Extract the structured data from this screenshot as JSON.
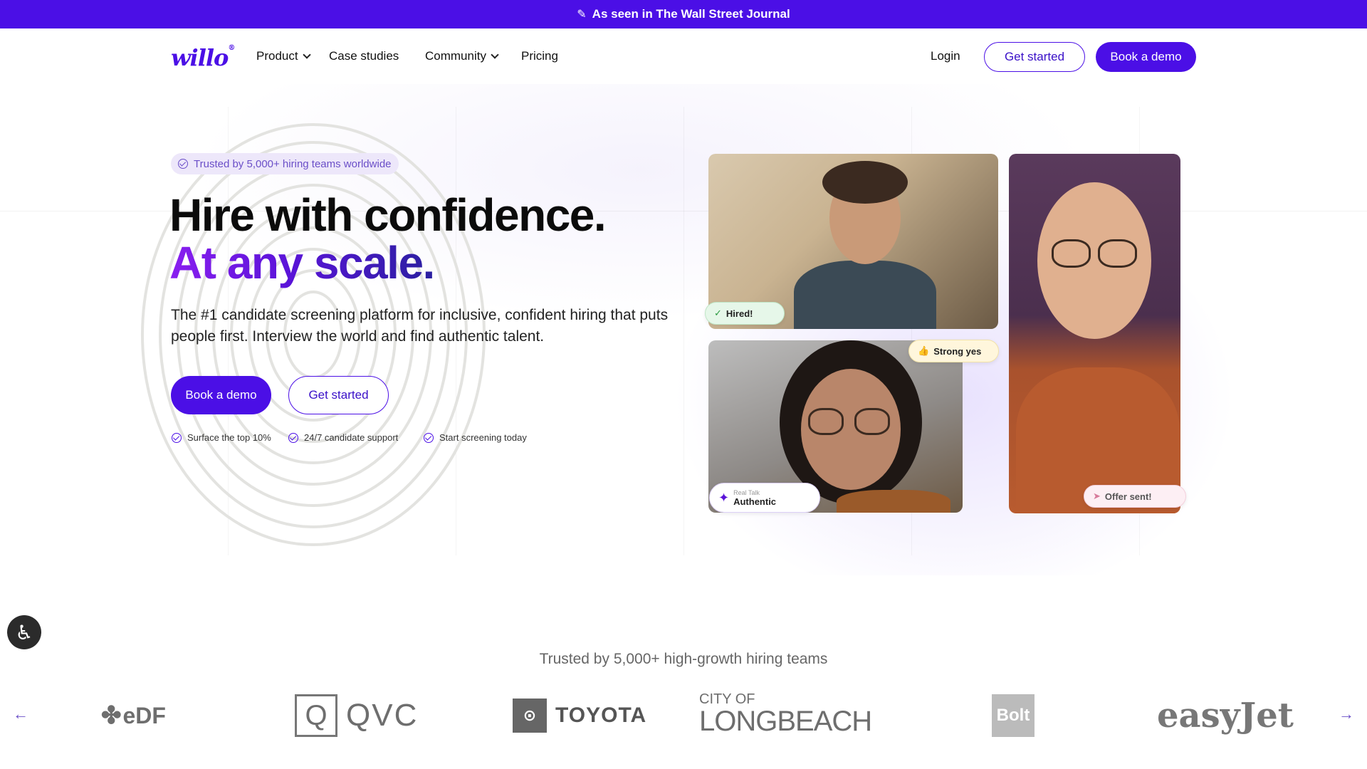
{
  "banner": {
    "icon": "pen-icon",
    "text": "As seen in The Wall Street Journal"
  },
  "nav": {
    "logo": "willo",
    "items": [
      {
        "label": "Product",
        "has_dropdown": true
      },
      {
        "label": "Case studies",
        "has_dropdown": false
      },
      {
        "label": "Community",
        "has_dropdown": true
      },
      {
        "label": "Pricing",
        "has_dropdown": false
      }
    ],
    "login": "Login",
    "get_started": "Get started",
    "book_demo": "Book a demo"
  },
  "hero": {
    "trust_pill": "Trusted by 5,000+ hiring teams worldwide",
    "headline_1": "Hire with confidence.",
    "headline_2": "At any scale.",
    "subtext": "The #1 candidate screening platform for inclusive, confident hiring that puts people first. Interview the world and find authentic talent.",
    "primary_cta": "Book a demo",
    "secondary_cta": "Get started",
    "features": [
      "Surface the top 10%",
      "24/7 candidate support",
      "Start screening today"
    ],
    "tags": {
      "hired": "Hired!",
      "strong_yes": "Strong yes",
      "real_talk_label": "Real Talk",
      "authentic": "Authentic",
      "offer_sent": "Offer sent!"
    }
  },
  "trusted": {
    "title": "Trusted by 5,000+ high-growth hiring teams",
    "logos": [
      {
        "name": "EDF",
        "text": "eDF"
      },
      {
        "name": "QVC",
        "text": "QVC"
      },
      {
        "name": "Toyota",
        "text": "TOYOTA"
      },
      {
        "name": "City of Long Beach",
        "text_top": "CITY OF",
        "text_bottom": "LONGBEACH"
      },
      {
        "name": "Bolt",
        "text": "Bolt"
      },
      {
        "name": "easyJet",
        "text": "easyJet"
      }
    ]
  },
  "colors": {
    "brand": "#4B0FE6",
    "hired_bg": "#E6F7E9",
    "strong_bg": "#FFF6DC",
    "offer_bg": "#FDEFF4"
  }
}
